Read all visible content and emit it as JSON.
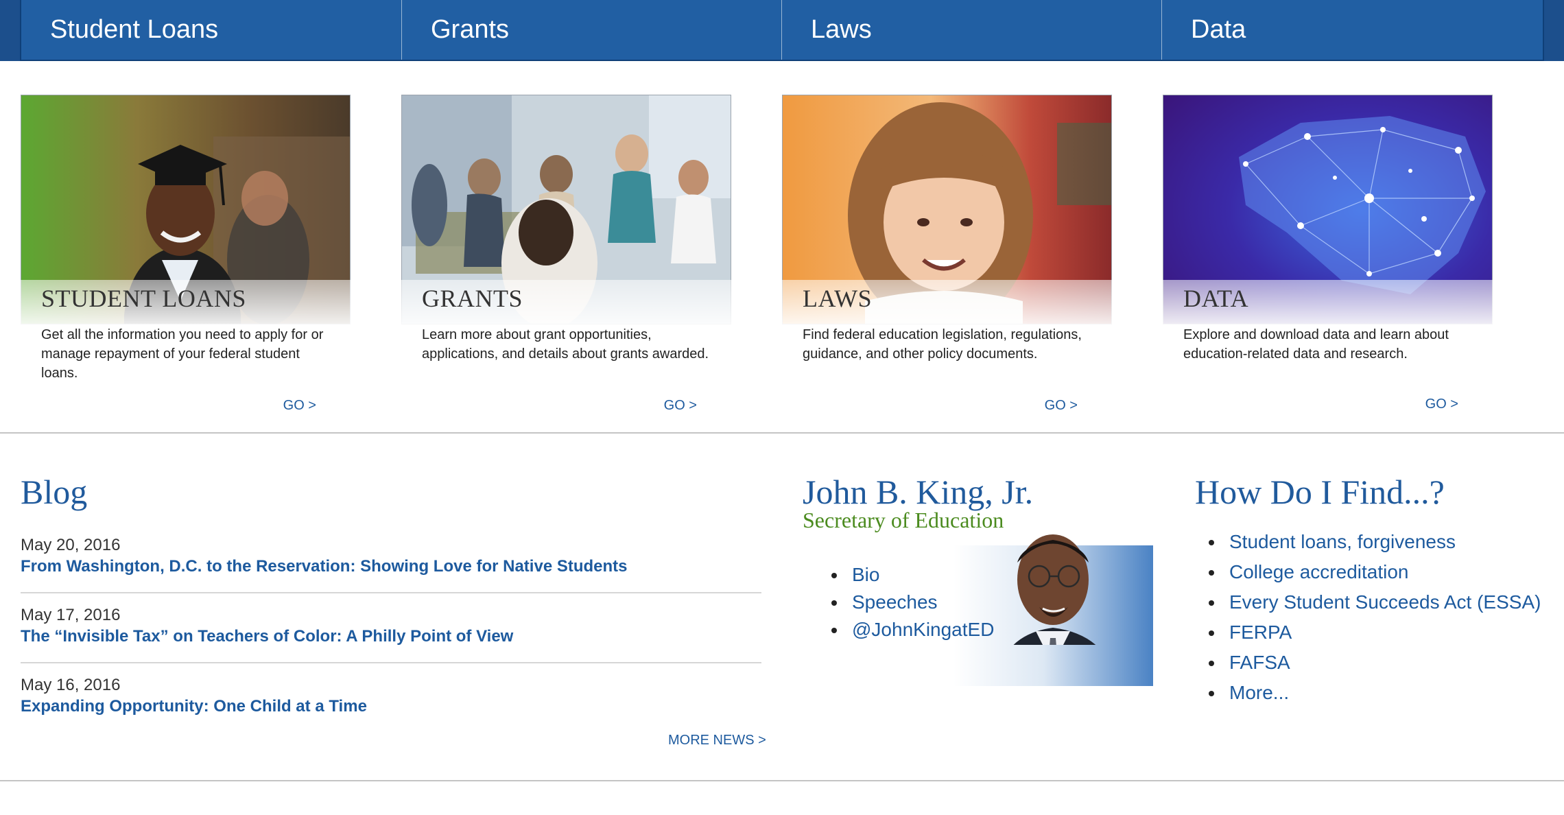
{
  "topnav": {
    "tabs": [
      {
        "label": "Student Loans"
      },
      {
        "label": "Grants"
      },
      {
        "label": "Laws"
      },
      {
        "label": "Data"
      }
    ]
  },
  "cards": [
    {
      "title": "STUDENT LOANS",
      "description": "Get all the information you need to apply for or manage repayment of your federal student loans.",
      "go": "GO >"
    },
    {
      "title": "GRANTS",
      "description": "Learn more about grant opportunities, applications, and details about grants awarded.",
      "go": "GO >"
    },
    {
      "title": "LAWS",
      "description": "Find federal education legislation, regulations, guidance, and other policy documents.",
      "go": "GO >"
    },
    {
      "title": "DATA",
      "description": "Explore and download data and learn about education-related data and research.",
      "go": "GO >"
    }
  ],
  "blog": {
    "heading": "Blog",
    "posts": [
      {
        "date": "May 20, 2016",
        "title": "From Washington, D.C. to the Reservation: Showing Love for Native Students"
      },
      {
        "date": "May 17, 2016",
        "title": "The “Invisible Tax” on Teachers of Color: A Philly Point of View"
      },
      {
        "date": "May 16, 2016",
        "title": "Expanding Opportunity: One Child at a Time"
      }
    ],
    "more": "MORE NEWS >"
  },
  "secretary": {
    "name": "John B. King, Jr.",
    "title": "Secretary of Education",
    "links": [
      "Bio",
      "Speeches",
      "@JohnKingatED"
    ]
  },
  "find": {
    "heading": "How Do I Find...?",
    "links": [
      "Student loans, forgiveness",
      "College accreditation",
      "Every Student Succeeds Act (ESSA)",
      "FERPA",
      "FAFSA",
      "More..."
    ]
  },
  "colors": {
    "nav_blue": "#215fa3",
    "link_blue": "#1d5a9e",
    "heading_blue": "#205a9c",
    "secretary_green": "#4b8b1f"
  }
}
